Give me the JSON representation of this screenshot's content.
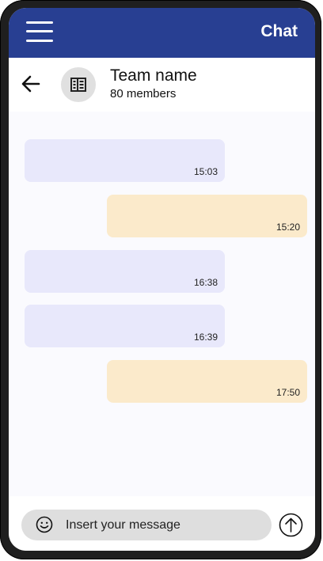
{
  "topbar": {
    "title": "Chat",
    "background": "#283f92"
  },
  "header": {
    "team_name": "Team name",
    "member_count": "80 members"
  },
  "messages": [
    {
      "direction": "incoming",
      "time": "15:03"
    },
    {
      "direction": "outgoing",
      "time": "15:20"
    },
    {
      "direction": "incoming",
      "time": "16:38"
    },
    {
      "direction": "incoming",
      "time": "16:39"
    },
    {
      "direction": "outgoing",
      "time": "17:50"
    }
  ],
  "composer": {
    "placeholder": "Insert your message"
  },
  "colors": {
    "incoming_bubble": "#e8e8fb",
    "outgoing_bubble": "#fbeacb"
  },
  "icons": [
    "menu-icon",
    "back-arrow-icon",
    "team-building-icon",
    "smiley-icon",
    "send-arrow-icon"
  ]
}
